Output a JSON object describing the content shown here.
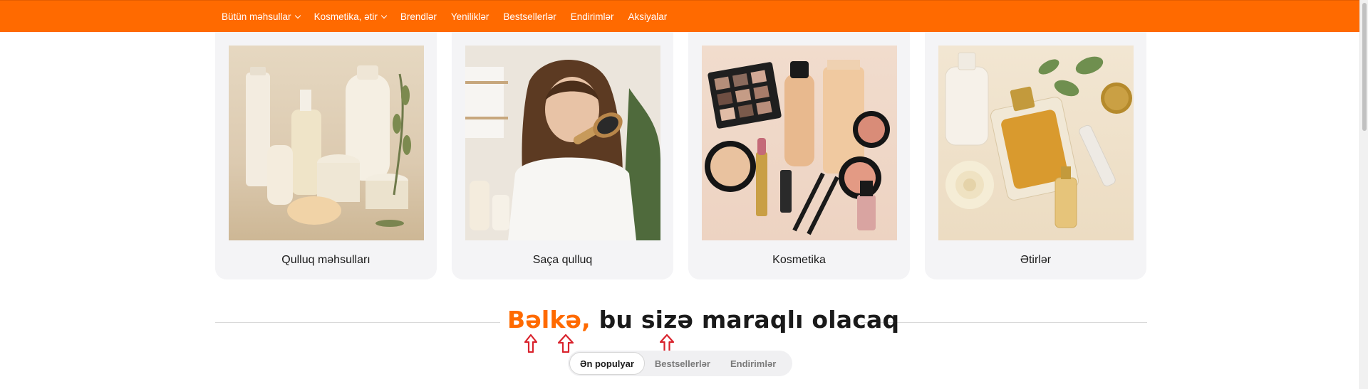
{
  "nav": {
    "items": [
      {
        "label": "Bütün məhsullar",
        "dropdown": true
      },
      {
        "label": "Kosmetika, ətir",
        "dropdown": true
      },
      {
        "label": "Brendlər",
        "dropdown": false
      },
      {
        "label": "Yeniliklər",
        "dropdown": false
      },
      {
        "label": "Bestsellerlər",
        "dropdown": false
      },
      {
        "label": "Endirimlər",
        "dropdown": false
      },
      {
        "label": "Aksiyalar",
        "dropdown": false
      }
    ]
  },
  "categories": [
    {
      "label": "Qulluq məhsulları",
      "image": "skincare-products-image"
    },
    {
      "label": "Saça qulluq",
      "image": "hair-care-image"
    },
    {
      "label": "Kosmetika",
      "image": "makeup-products-image"
    },
    {
      "label": "Ətirlər",
      "image": "perfume-image"
    }
  ],
  "section": {
    "title_accent": "Bəlkə,",
    "title_rest": " bu sizə maraqlı olacaq",
    "tabs": [
      {
        "label": "Ən populyar",
        "active": true
      },
      {
        "label": "Bestsellerlər",
        "active": false
      },
      {
        "label": "Endirimlər",
        "active": false
      }
    ]
  },
  "colors": {
    "brand": "#ff6a00",
    "annotation_arrow": "#d9232d",
    "card_bg": "#f4f4f6"
  }
}
